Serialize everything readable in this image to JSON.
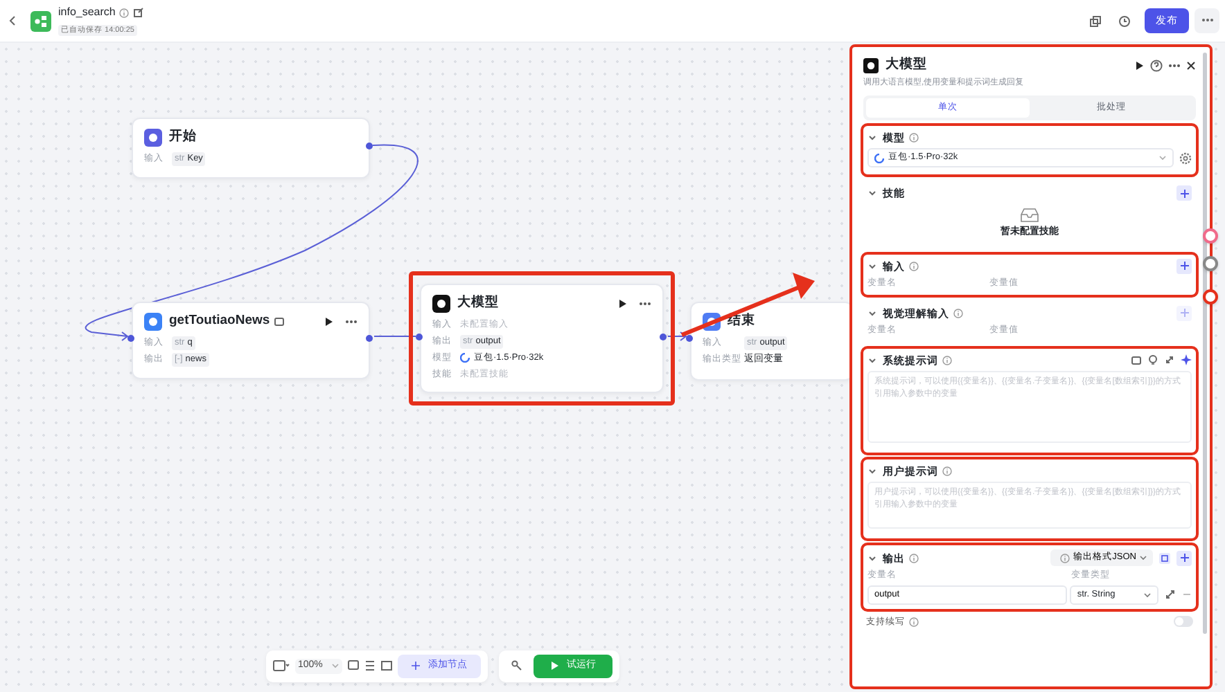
{
  "header": {
    "title": "info_search",
    "saved_text": "已自动保存 14:00:25",
    "publish_label": "发布"
  },
  "nodes": [
    {
      "kind": "start",
      "title": "开始",
      "color": "#5b5fe0",
      "title_badge": false,
      "actions": false,
      "highlighted": false,
      "rows": [
        {
          "label": "输入",
          "tag": "str",
          "value": "Key"
        }
      ]
    },
    {
      "kind": "plugin",
      "title": "getToutiaoNews",
      "color": "#3b82f6",
      "title_badge": true,
      "actions": true,
      "highlighted": false,
      "rows": [
        {
          "label": "输入",
          "tag": "str",
          "value": "q"
        },
        {
          "label": "输出",
          "tag": "[-]",
          "value": "news"
        }
      ]
    },
    {
      "kind": "llm",
      "title": "大模型",
      "color": "#111111",
      "title_badge": false,
      "actions": true,
      "highlighted": true,
      "rows": [
        {
          "label": "输入",
          "placeholder": "未配置输入"
        },
        {
          "label": "输出",
          "tag": "str",
          "value": "output"
        },
        {
          "label": "模型",
          "model": true,
          "value": "豆包·1.5·Pro·32k"
        },
        {
          "label": "技能",
          "placeholder": "未配置技能"
        }
      ]
    },
    {
      "kind": "end",
      "title": "结束",
      "color": "#4f7cf3",
      "title_badge": false,
      "actions": false,
      "highlighted": false,
      "rows": [
        {
          "label": "输入",
          "tag": "str",
          "value": "output"
        },
        {
          "label": "输出类型",
          "value": "返回变量"
        }
      ]
    }
  ],
  "panel": {
    "title": "大模型",
    "description": "调用大语言模型,使用变量和提示词生成回复",
    "tabs": [
      {
        "label": "单次",
        "selected": true
      },
      {
        "label": "批处理",
        "selected": false
      }
    ],
    "sections": [
      {
        "kind": "model",
        "title": "模型",
        "info": true,
        "highlighted": true,
        "value": "豆包·1.5·Pro·32k"
      },
      {
        "kind": "skills",
        "title": "技能",
        "info": false,
        "highlighted": false,
        "empty_text": "暂未配置技能"
      },
      {
        "kind": "vars",
        "title": "输入",
        "info": true,
        "highlighted": true,
        "add_disabled": false,
        "columns": [
          "变量名",
          "变量值"
        ]
      },
      {
        "kind": "vars",
        "title": "视觉理解输入",
        "info": true,
        "highlighted": false,
        "add_disabled": true,
        "columns": [
          "变量名",
          "变量值"
        ]
      },
      {
        "kind": "prompt",
        "title": "系统提示词",
        "info": true,
        "highlighted": true,
        "tools": true,
        "placeholder": "系统提示词，可以使用{{变量名}}、{{变量名.子变量名}}、{{变量名[数组索引]}}的方式引用输入参数中的变量"
      },
      {
        "kind": "prompt",
        "title": "用户提示词",
        "info": true,
        "highlighted": true,
        "tools": false,
        "placeholder": "用户提示词，可以使用{{变量名}}、{{变量名.子变量名}}、{{变量名[数组索引]}}的方式引用输入参数中的变量"
      },
      {
        "kind": "output",
        "title": "输出",
        "info": true,
        "highlighted": true,
        "format": "输出格式JSON",
        "columns": [
          "变量名",
          "变量类型"
        ],
        "rows": [
          {
            "name": "output",
            "type_tag": "str.",
            "type": "String"
          }
        ]
      }
    ],
    "continue_writing": {
      "label": "支持续写",
      "on": false
    }
  },
  "toolbar": {
    "zoom": "100%",
    "add_node_label": "添加节点",
    "run_label": "试运行"
  }
}
